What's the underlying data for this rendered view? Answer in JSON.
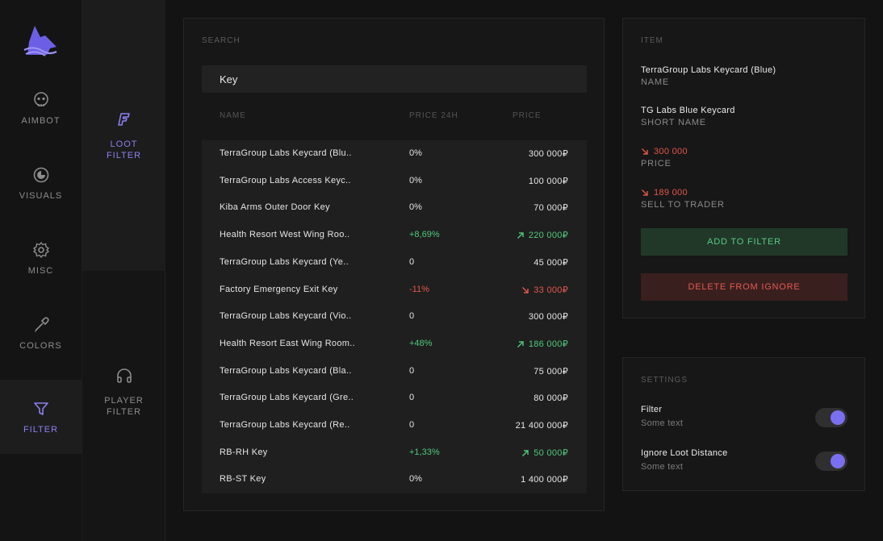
{
  "colors": {
    "accent": "#7a6ff0",
    "up": "#4fc97d",
    "down": "#e2574c"
  },
  "nav": {
    "items": [
      {
        "label": "AIMBOT",
        "icon": "skull-icon"
      },
      {
        "label": "VISUALS",
        "icon": "eye-circle-icon"
      },
      {
        "label": "MISC",
        "icon": "gear-icon"
      },
      {
        "label": "COLORS",
        "icon": "eyedropper-icon"
      },
      {
        "label": "FILTER",
        "icon": "filter-icon",
        "active": true
      }
    ]
  },
  "subnav": {
    "items": [
      {
        "label": "LOOT\nFILTER",
        "icon": "loot-filter-icon",
        "active": true
      },
      {
        "label": "PLAYER\nFILTER",
        "icon": "headset-icon"
      }
    ]
  },
  "search": {
    "title": "SEARCH",
    "value": "Key",
    "columns": {
      "name": "NAME",
      "change": "PRICE 24H",
      "price": "PRICE"
    },
    "rows": [
      {
        "name": "TerraGroup Labs Keycard (Blu..",
        "change": "0%",
        "trend": "",
        "price": "300 000₽"
      },
      {
        "name": "TerraGroup Labs Access Keyc..",
        "change": "0%",
        "trend": "",
        "price": "100 000₽"
      },
      {
        "name": "Kiba Arms Outer Door Key",
        "change": "0%",
        "trend": "",
        "price": "70 000₽"
      },
      {
        "name": "Health Resort West Wing Roo..",
        "change": "+8,69%",
        "trend": "up",
        "price": "220 000₽"
      },
      {
        "name": "TerraGroup Labs Keycard (Ye..",
        "change": "0",
        "trend": "",
        "price": "45 000₽"
      },
      {
        "name": "Factory Emergency Exit Key",
        "change": "-11%",
        "trend": "down",
        "price": "33 000₽"
      },
      {
        "name": "TerraGroup Labs Keycard (Vio..",
        "change": "0",
        "trend": "",
        "price": "300 000₽"
      },
      {
        "name": "Health Resort East Wing Room..",
        "change": "+48%",
        "trend": "up",
        "price": "186 000₽"
      },
      {
        "name": "TerraGroup Labs Keycard (Bla..",
        "change": "0",
        "trend": "",
        "price": "75 000₽"
      },
      {
        "name": "TerraGroup Labs Keycard (Gre..",
        "change": "0",
        "trend": "",
        "price": "80 000₽"
      },
      {
        "name": "TerraGroup Labs Keycard (Re..",
        "change": "0",
        "trend": "",
        "price": "21 400 000₽"
      },
      {
        "name": "RB-RH Key",
        "change": "+1,33%",
        "trend": "up",
        "price": "50 000₽"
      },
      {
        "name": "RB-ST Key",
        "change": "0%",
        "trend": "",
        "price": "1 400 000₽"
      }
    ]
  },
  "item": {
    "title": "ITEM",
    "name_value": "TerraGroup Labs Keycard (Blue)",
    "name_label": "NAME",
    "short_value": "TG Labs Blue Keycard",
    "short_label": "SHORT NAME",
    "price_value": "300 000",
    "price_label": "PRICE",
    "sell_value": "189 000",
    "sell_label": "SELL TO TRADER",
    "add_label": "ADD TO FILTER",
    "delete_label": "DELETE FROM IGNORE"
  },
  "settings": {
    "title": "SETTINGS",
    "rows": [
      {
        "name": "Filter",
        "desc": "Some text",
        "on": true
      },
      {
        "name": "Ignore Loot Distance",
        "desc": "Some text",
        "on": true
      }
    ]
  }
}
